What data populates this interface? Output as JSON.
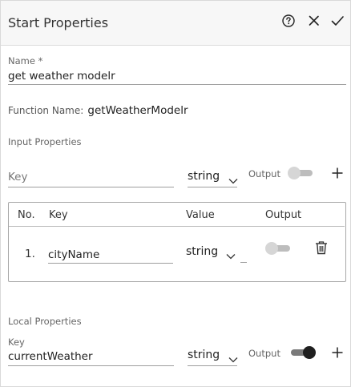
{
  "header": {
    "title": "Start Properties"
  },
  "name_field": {
    "label": "Name *",
    "value": "get weather modelr"
  },
  "function_name": {
    "label": "Function Name:",
    "value": "getWeatherModelr"
  },
  "input_properties": {
    "section_title": "Input Properties",
    "key_placeholder": "Key",
    "type_value": "string",
    "output_label": "Output",
    "output_on": false,
    "table": {
      "columns": [
        "No.",
        "Key",
        "Value",
        "Output"
      ],
      "rows": [
        {
          "no": "1.",
          "key": "cityName",
          "type": "string",
          "output_on": false
        }
      ]
    }
  },
  "local_properties": {
    "section_title": "Local Properties",
    "key_label": "Key",
    "key_value": "currentWeather",
    "type_value": "string",
    "output_label": "Output",
    "output_on": true
  },
  "icons": {
    "help": "help-circle-icon",
    "close": "close-icon",
    "confirm": "check-icon",
    "add": "plus-icon",
    "delete": "trash-icon",
    "dropdown": "chevron-down-icon"
  }
}
